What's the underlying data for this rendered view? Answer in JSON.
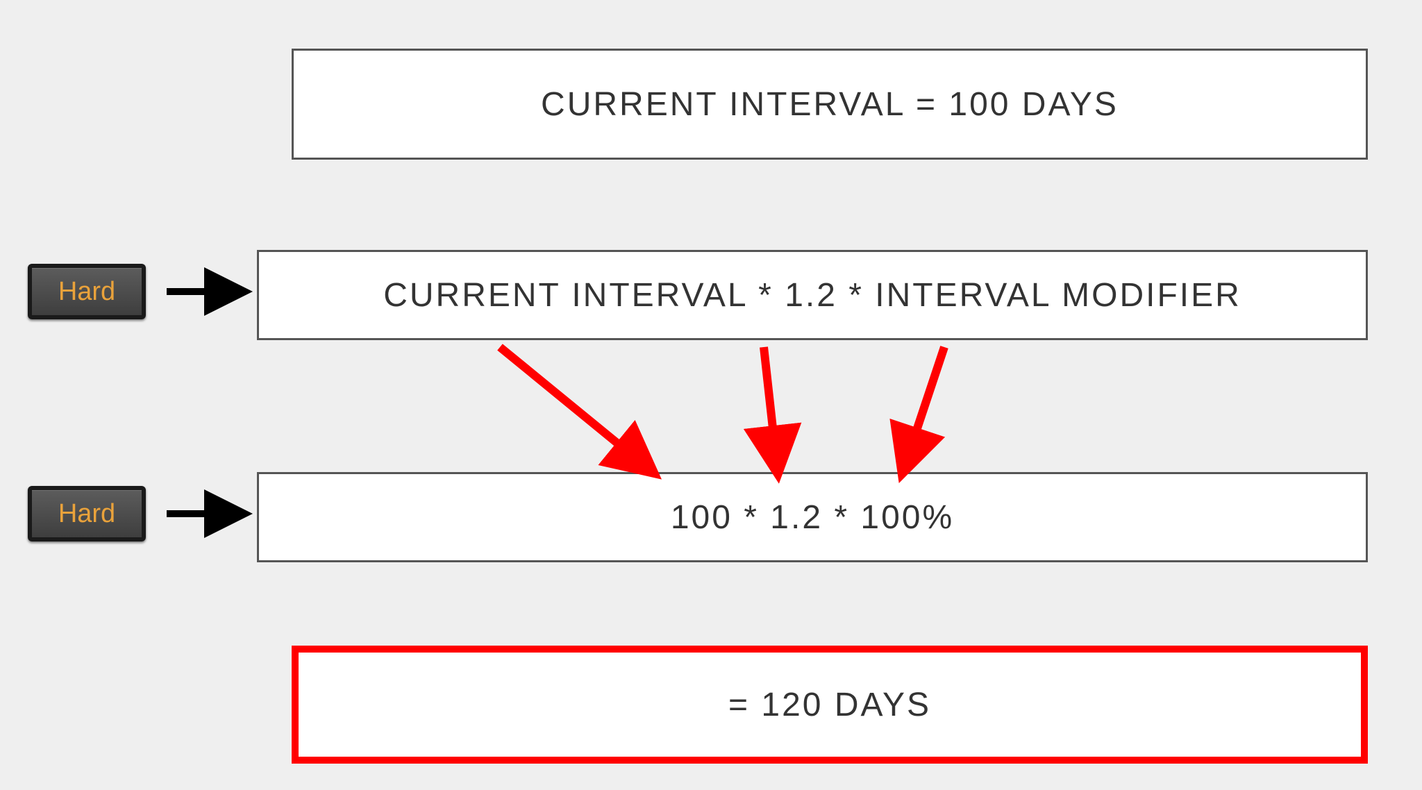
{
  "diagram": {
    "button_label": "Hard",
    "box1": "CURRENT INTERVAL = 100 DAYS",
    "box2": "CURRENT INTERVAL * 1.2 * INTERVAL MODIFIER",
    "box3": "100 * 1.2 * 100%",
    "box4": "= 120 DAYS",
    "colors": {
      "highlight_border": "#ff0000",
      "arrow_black": "#000000",
      "arrow_red": "#ff0000",
      "button_text": "#e9a23b"
    },
    "values": {
      "current_interval_days": 100,
      "hard_multiplier": 1.2,
      "interval_modifier_pct": 100,
      "result_days": 120
    }
  }
}
